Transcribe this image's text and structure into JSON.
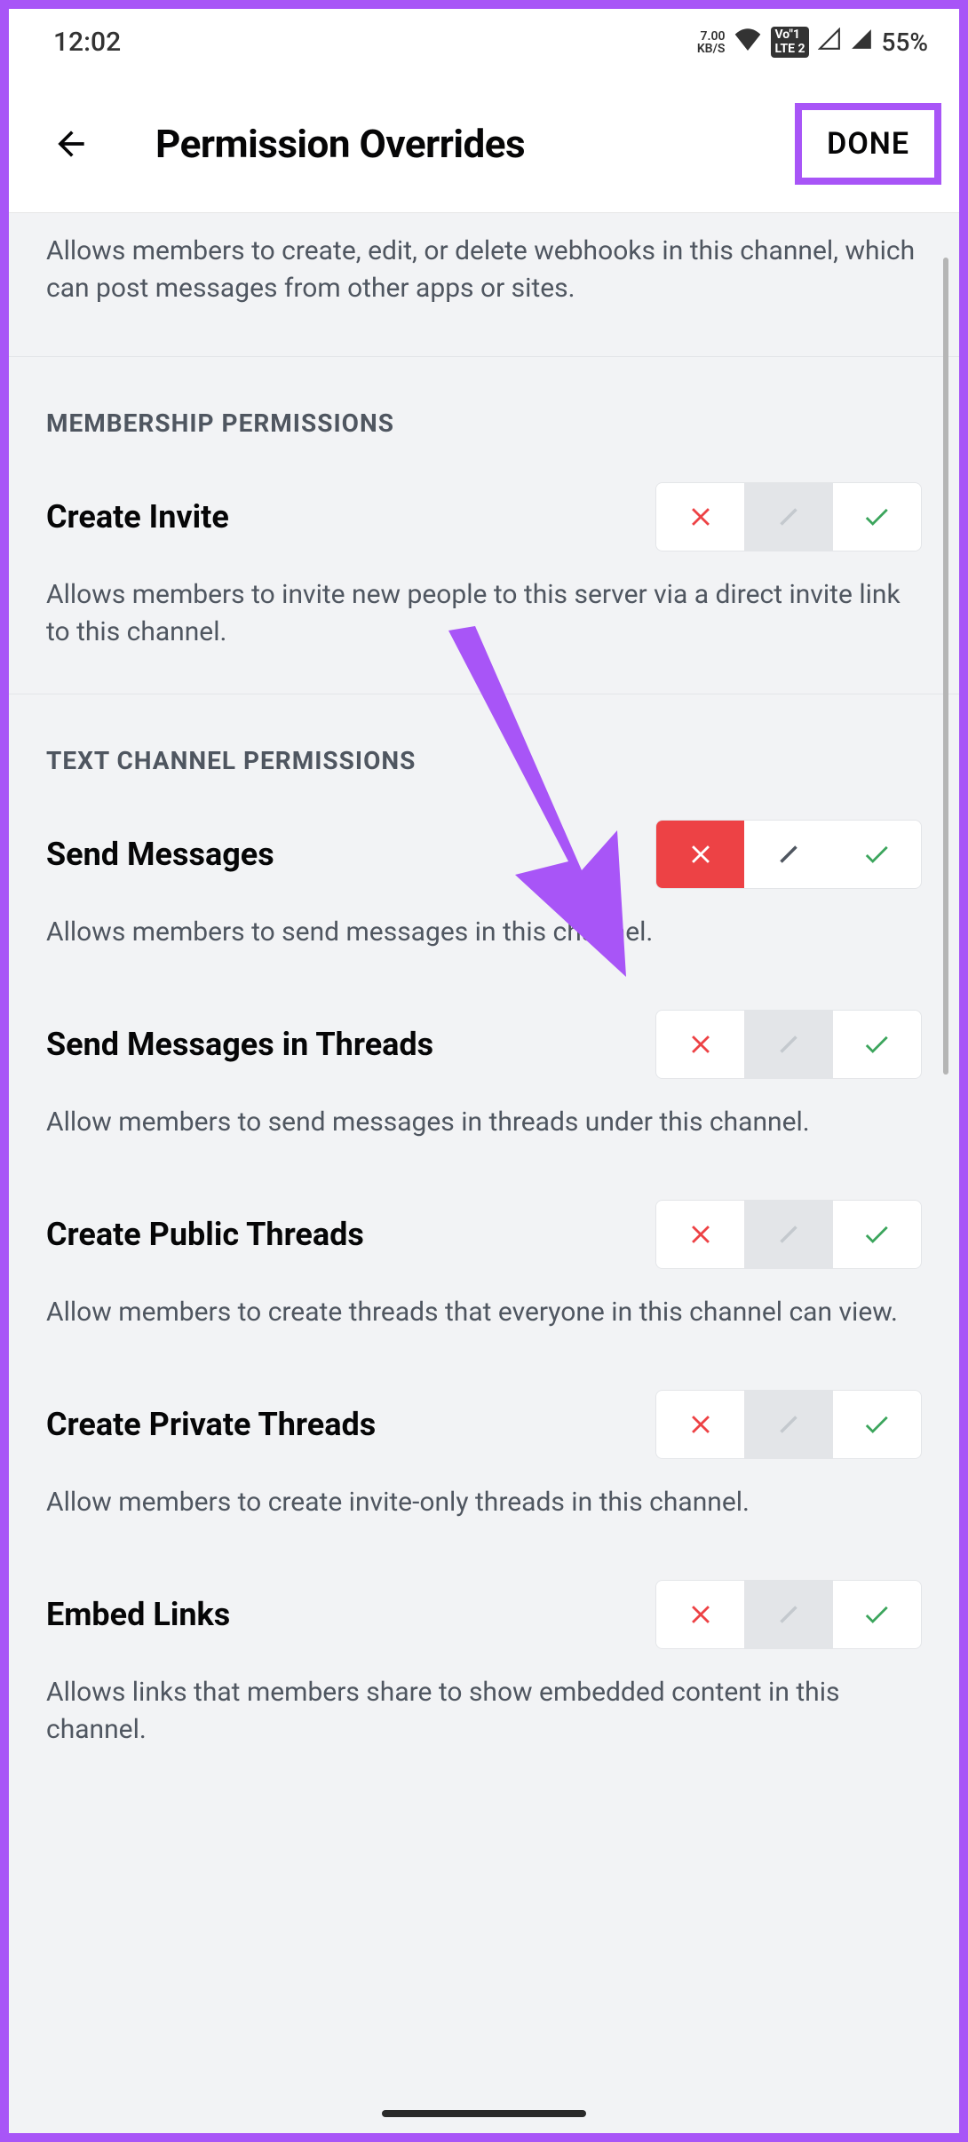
{
  "statusBar": {
    "time": "12:02",
    "kbs_top": "7.00",
    "kbs_bottom": "KB/S",
    "lte": "Vo1\nLTE 2",
    "battery": "55%"
  },
  "header": {
    "title": "Permission Overrides",
    "done": "DONE"
  },
  "intro": {
    "desc": "Allows members to create, edit, or delete webhooks in this channel, which can post messages from other apps or sites."
  },
  "sections": [
    {
      "title": "MEMBERSHIP PERMISSIONS",
      "permissions": [
        {
          "title": "Create Invite",
          "desc": "Allows members to invite new people to this server via a direct invite link to this channel.",
          "state": "neutral"
        }
      ]
    },
    {
      "title": "TEXT CHANNEL PERMISSIONS",
      "permissions": [
        {
          "title": "Send Messages",
          "desc": "Allows members to send messages in this channel.",
          "state": "deny"
        },
        {
          "title": "Send Messages in Threads",
          "desc": "Allow members to send messages in threads under this channel.",
          "state": "neutral"
        },
        {
          "title": "Create Public Threads",
          "desc": "Allow members to create threads that everyone in this channel can view.",
          "state": "neutral"
        },
        {
          "title": "Create Private Threads",
          "desc": "Allow members to create invite-only threads in this channel.",
          "state": "neutral"
        },
        {
          "title": "Embed Links",
          "desc": "Allows links that members share to show embedded content in this channel.",
          "state": "neutral"
        }
      ]
    }
  ]
}
